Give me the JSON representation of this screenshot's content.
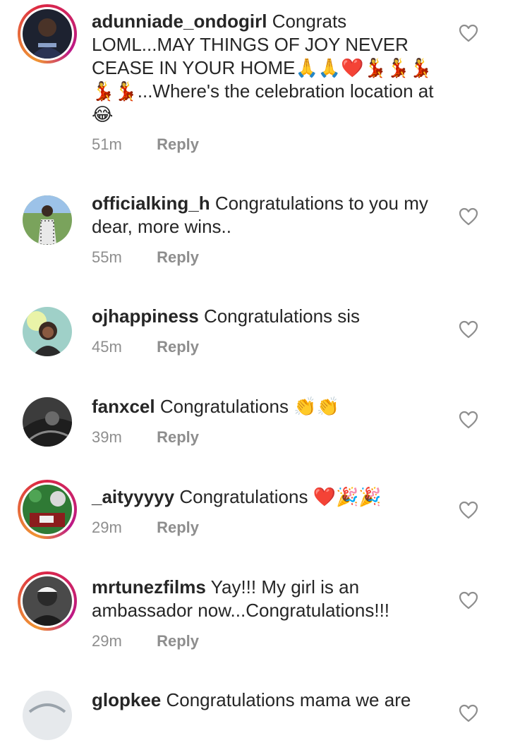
{
  "comments": [
    {
      "username": "adunniade_ondogirl",
      "text": "Congrats LOML...MAY THINGS OF JOY NEVER CEASE IN YOUR HOME🙏🙏❤️💃💃💃💃💃...Where's the celebration location at😂",
      "time": "51m",
      "reply": "Reply"
    },
    {
      "username": "officialking_h",
      "text": "Congratulations to you my dear, more wins..",
      "time": "55m",
      "reply": "Reply"
    },
    {
      "username": "ojhappiness",
      "text": "Congratulations sis",
      "time": "45m",
      "reply": "Reply"
    },
    {
      "username": "fanxcel",
      "text": "Congratulations 👏👏",
      "time": "39m",
      "reply": "Reply"
    },
    {
      "username": "_aityyyyy",
      "text": "Congratulations ❤️🎉🎉",
      "time": "29m",
      "reply": "Reply"
    },
    {
      "username": "mrtunezfilms",
      "text": "Yay!!! My girl is an ambassador now...Congratulations!!!",
      "time": "29m",
      "reply": "Reply"
    },
    {
      "username": "glopkee",
      "text": "Congratulations mama we are",
      "time": "",
      "reply": ""
    }
  ],
  "icons": {
    "like": "heart-outline-icon"
  },
  "colors": {
    "text": "#262626",
    "muted": "#8e8e8e",
    "story_ring_start": "#f09433",
    "story_ring_end": "#bc1888"
  }
}
